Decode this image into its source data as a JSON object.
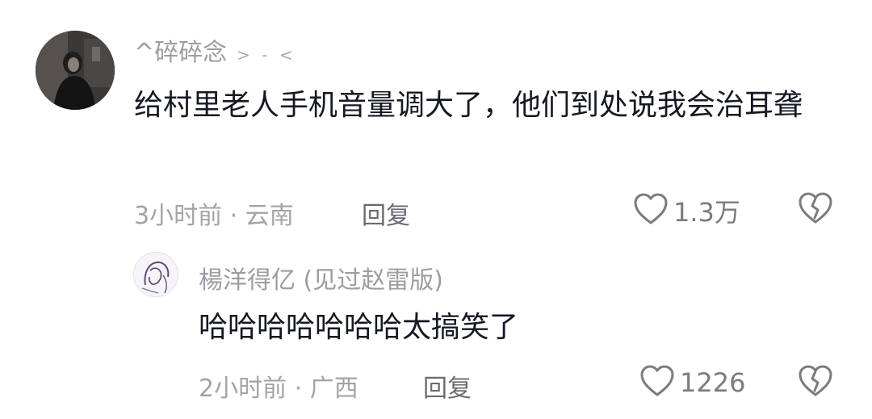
{
  "comments": [
    {
      "username": "^碎碎念",
      "username_tag": "> - <",
      "content": "给村里老人手机音量调大了，他们到处说我会治耳聋",
      "time": "3小时前",
      "location": "云南",
      "reply_label": "回复",
      "like_count": "1.3万"
    },
    {
      "username": "楊洋得亿 (见过赵雷版)",
      "content": "哈哈哈哈哈哈哈太搞笑了",
      "time": "2小时前",
      "location": "广西",
      "reply_label": "回复",
      "like_count": "1226"
    }
  ],
  "icons": {
    "like": "heart-outline-icon",
    "dislike": "broken-heart-icon"
  },
  "colors": {
    "text": "#161823",
    "secondary": "#9c9ca3"
  }
}
